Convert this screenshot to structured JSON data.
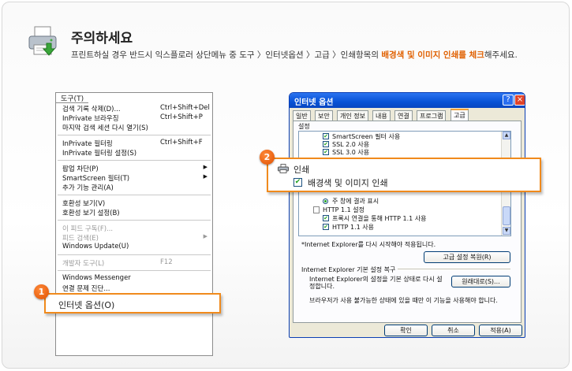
{
  "header": {
    "title": "주의하세요",
    "subtitle_pre": "프린트하실 경우 반드시 익스플로러 상단메뉴 중 도구 〉인터넷옵션 〉고급 〉인쇄항목의 ",
    "subtitle_highlight": "배경색 및 이미지 인쇄를 체크",
    "subtitle_post": "해주세요."
  },
  "menu": {
    "bar_label": "도구(T)",
    "items": [
      {
        "label": "검색 기록 삭제(D)...",
        "shortcut": "Ctrl+Shift+Del"
      },
      {
        "label": "InPrivate 브라우징",
        "shortcut": "Ctrl+Shift+P"
      },
      {
        "label": "마지막 검색 세션 다시 열기(S)",
        "shortcut": ""
      },
      {
        "label": "InPrivate 필터링",
        "shortcut": "Ctrl+Shift+F"
      },
      {
        "label": "InPrivate 필터링 설정(S)",
        "shortcut": ""
      },
      {
        "label": "팝업 차단(P)",
        "shortcut": ""
      },
      {
        "label": "SmartScreen 필터(T)",
        "shortcut": ""
      },
      {
        "label": "추가 기능 관리(A)",
        "shortcut": ""
      },
      {
        "label": "호환성 보기(V)",
        "shortcut": ""
      },
      {
        "label": "호환성 보기 설정(B)",
        "shortcut": ""
      },
      {
        "label": "이 피드 구독(F)...",
        "shortcut": ""
      },
      {
        "label": "피드 검색(E)",
        "shortcut": ""
      },
      {
        "label": "Windows Update(U)",
        "shortcut": ""
      },
      {
        "label": "개발자 도구(L)",
        "shortcut": "F12"
      },
      {
        "label": "Windows Messenger",
        "shortcut": ""
      },
      {
        "label": "연결 문제 진단...",
        "shortcut": ""
      }
    ],
    "highlight_label": "인터넷 옵션(O)"
  },
  "badges": {
    "one": "1",
    "two": "2"
  },
  "dialog": {
    "title": "인터넷 옵션",
    "help": "?",
    "close": "×",
    "tabs": [
      "일반",
      "보안",
      "개인 정보",
      "내용",
      "연결",
      "프로그램",
      "고급"
    ],
    "settings_label": "설정",
    "list_items": [
      "SmartScreen 필터 사용",
      "SSL 2.0 사용",
      "SSL 3.0 사용",
      "주 창에 결과 표시",
      "HTTP 1.1 설정",
      "프록시 연결을 통해 HTTP 1.1 사용",
      "HTTP 1.1 사용"
    ],
    "restart_note": "*Internet Explorer를 다시 시작해야 적용됩니다.",
    "restore_advanced_button": "고급 설정 복원(R)",
    "reset_group_title": "Internet Explorer 기본 설정 복구",
    "reset_desc_line1": "Internet Explorer의 설정을 기본 상태로 다시 설",
    "reset_desc_line2": "정합니다.",
    "reset_button": "원래대로(S)...",
    "broken_note": "브라우저가 사용 불가능한 상태에 있을 때만 이 기능을 사용해야 합니다.",
    "ok_button": "확인",
    "cancel_button": "취소",
    "apply_button": "적용(A)"
  },
  "print_callout": {
    "label": "인쇄",
    "checkbox_label": "배경색 및 이미지 인쇄",
    "check": "✔"
  },
  "icons": {
    "arrow": "▶",
    "scroll_up": "▲",
    "scroll_down": "▼"
  }
}
